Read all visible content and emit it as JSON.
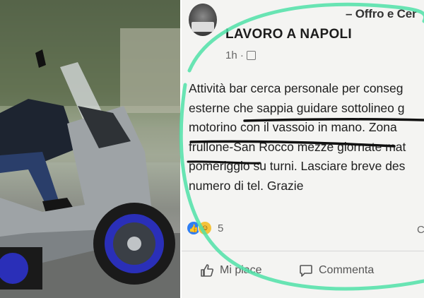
{
  "post": {
    "header_right": "– Offro e Cer",
    "group_name": "LAVORO A NAPOLI",
    "time": "1h ·",
    "body_lines": [
      "Attività bar cerca personale per conseg",
      "esterne che sappia guidare sottolineo g",
      "motorino con il vassoio in mano. Zona",
      "frullone-San Rocco mezze giornate mat",
      "pomeriggio su turni. Lasciare breve des",
      "numero di tel. Grazie"
    ],
    "reaction_count": "5",
    "reaction_right": "C",
    "actions": {
      "like": "Mi piace",
      "comment": "Commenta"
    }
  },
  "icons": {
    "avatar": "group-avatar",
    "group": "group-icon",
    "like_reaction": "like-reaction-icon",
    "haha_reaction": "haha-reaction-icon",
    "like_action": "thumbs-up-icon",
    "comment_action": "comment-bubble-icon"
  },
  "colors": {
    "highlight_circle": "#4fe0a8",
    "underline": "#111111",
    "like_blue": "#2f7ef3",
    "haha_yellow": "#f5c33b"
  }
}
